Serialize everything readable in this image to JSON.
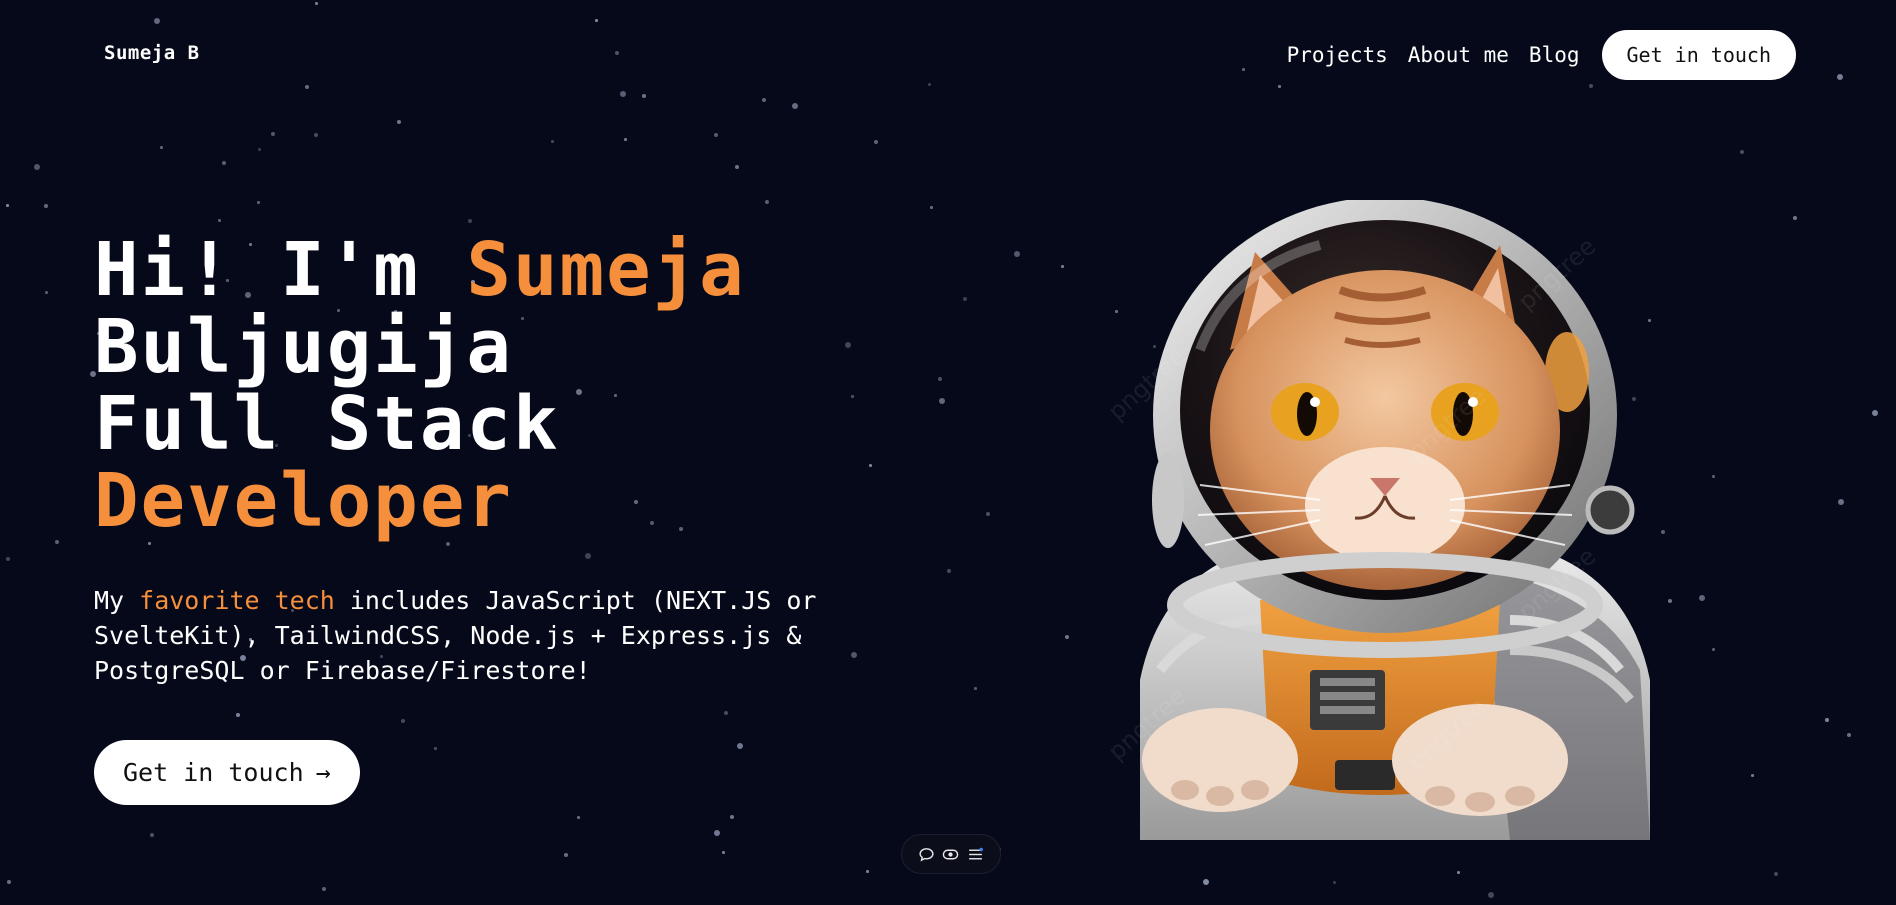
{
  "nav": {
    "logo": "Sumeja B",
    "links": [
      "Projects",
      "About me",
      "Blog"
    ],
    "cta_label": "Get in touch"
  },
  "hero": {
    "line1_prefix": "Hi! I'm ",
    "line1_accent": "Sumeja",
    "line2": "Buljugija",
    "line3": "Full Stack",
    "line4_accent": "Developer",
    "desc_prefix": "My ",
    "desc_accent": "favorite tech",
    "desc_line1_rest": " includes JavaScript (NEXT.JS or",
    "desc_line2": "SvelteKit), TailwindCSS, Node.js + Express.js &",
    "desc_line3": "PostgreSQL or Firebase/Firestore!",
    "cta_label": "Get in touch",
    "cta_arrow": "→"
  },
  "illustration": {
    "subject": "cat-astronaut",
    "watermark": "pngtree"
  },
  "toolbar": {
    "icons": [
      "comment-icon",
      "eye-icon",
      "menu-icon"
    ]
  },
  "colors": {
    "background": "#060919",
    "accent": "#f58f3b",
    "text": "#ffffff",
    "button_bg": "#ffffff"
  }
}
